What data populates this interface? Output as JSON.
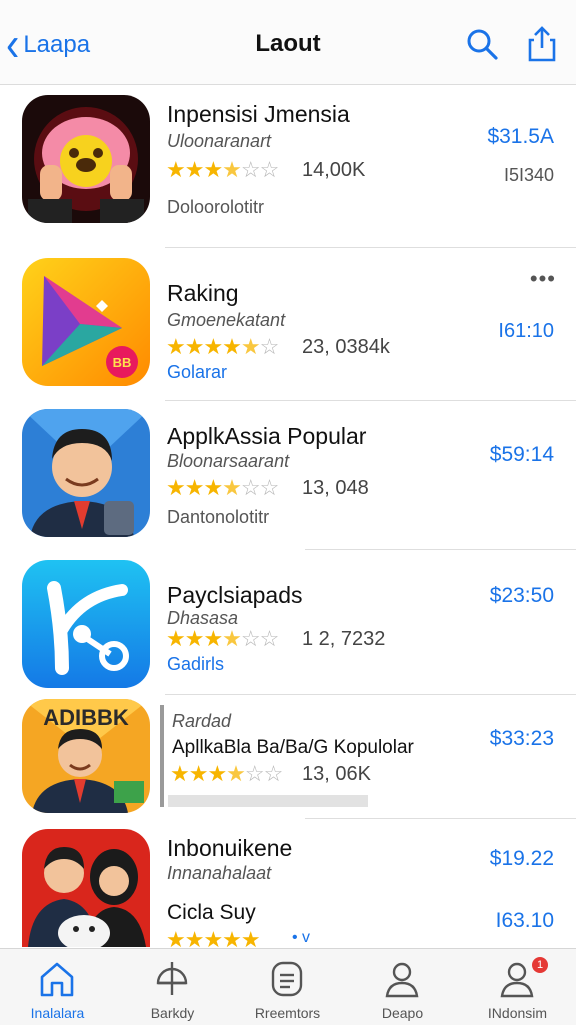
{
  "header": {
    "back_label": "Laapa",
    "title": "Laout",
    "search_icon": "search-icon",
    "share_icon": "share-icon"
  },
  "apps": [
    {
      "name": "Inpensisi  Jmensia",
      "subtitle": "Uloonaranart",
      "rating": 3.5,
      "stars": "★★★★☆☆",
      "rating_count": "14,00K",
      "category": "Doloorolotitr",
      "price": "$31.5A",
      "price_note": "I5I340"
    },
    {
      "name": "Raking",
      "subtitle": "Gmoenekatant",
      "rating": 4.5,
      "stars": "★★★★★☆",
      "rating_count": "23, 0384k",
      "category": "Golarar",
      "price": "I61:10",
      "more": "•••"
    },
    {
      "name": "ApplkAssia Popular",
      "subtitle": "Bloonarsaarant",
      "rating": 3.5,
      "stars": "★★★★☆☆",
      "rating_count": "13, 048",
      "category": "Dantonolotitr",
      "price": "$59:14"
    },
    {
      "name": "Payclsiapads",
      "subtitle": "Dhasasa",
      "rating": 3.5,
      "stars": "★★★★☆☆",
      "rating_count": "1 2, 7232",
      "category": "Gadirls",
      "price": "$23:50"
    },
    {
      "name": "ApllkaBla Ba/Ba/G Kopulolar",
      "subtitle": "Rardad",
      "rating": 3.5,
      "stars": "★★★★☆☆",
      "rating_count": "13, 06K",
      "price": "$33:23"
    },
    {
      "name": "Inbonuikene",
      "subtitle": "Innanahalaat",
      "rating": 4.5,
      "stars": "★★★★★",
      "rating_count": "• v",
      "category": "Cicla Suy",
      "price": "$19.22",
      "price_note": "I63.10"
    }
  ],
  "tabbar": [
    {
      "label": "Inalalara",
      "icon": "home-icon",
      "active": true
    },
    {
      "label": "Barkdy",
      "icon": "compass-icon",
      "active": false
    },
    {
      "label": "Rreemtors",
      "icon": "list-card-icon",
      "active": false
    },
    {
      "label": "Deapo",
      "icon": "person-icon",
      "active": false
    },
    {
      "label": "INdonsim",
      "icon": "profile-icon",
      "active": false,
      "badge": "1"
    }
  ],
  "colors": {
    "accent": "#1a73e8",
    "star": "#f7b500",
    "badge": "#e53935"
  }
}
